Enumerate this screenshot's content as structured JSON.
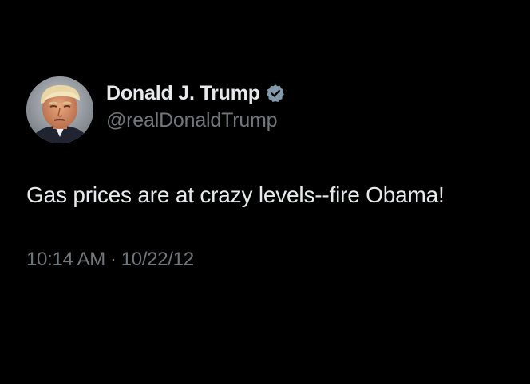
{
  "colors": {
    "background": "#000000",
    "primary_text": "#e7e9ea",
    "secondary_text": "#71767b",
    "verified_badge": "#829aab"
  },
  "author": {
    "display_name": "Donald J. Trump",
    "handle": "@realDonaldTrump",
    "verified_icon": "verified-badge-icon",
    "avatar_icon": "profile-photo"
  },
  "tweet": {
    "text": "Gas prices are at crazy levels--fire Obama!",
    "time": "10:14 AM",
    "separator": "·",
    "date": "10/22/12"
  }
}
